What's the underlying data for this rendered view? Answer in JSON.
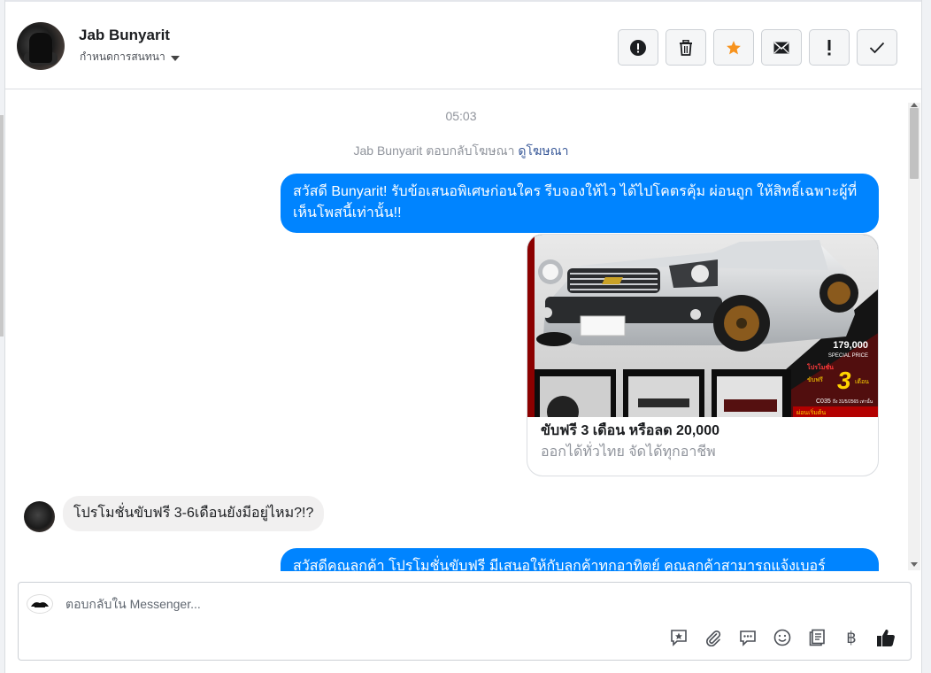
{
  "header": {
    "name": "Jab Bunyarit",
    "assign_label": "กำหนดการสนทนา",
    "actions": [
      {
        "icon": "alert-circle-icon"
      },
      {
        "icon": "trash-icon"
      },
      {
        "icon": "star-icon"
      },
      {
        "icon": "envelope-icon"
      },
      {
        "icon": "exclamation-icon"
      },
      {
        "icon": "check-icon"
      }
    ]
  },
  "thread": {
    "time": "05:03",
    "reply_note_prefix": "Jab Bunyarit ตอบกลับโฆษณา",
    "reply_note_link": "ดูโฆษณา",
    "msg1": "สวัสดี Bunyarit! รับข้อเสนอพิเศษก่อนใคร รีบจองให้ไว ได้ไปโคตรคุ้ม ผ่อนถูก ให้สิทธิ์เฉพาะผู้ที่เห็นโพสนี้เท่านั้น!!",
    "card": {
      "title": "ขับฟรี 3 เดือน หรือลด 20,000",
      "subtitle": "ออกได้ทั่วไทย จัดได้ทุกอาชีพ",
      "image_price": "179,000",
      "image_special": "SPECIAL PRICE",
      "image_promo_line1": "โปรโมชั่น",
      "image_promo_line2": "ขับฟรี",
      "image_promo_num": "3",
      "image_promo_unit": "เดือน",
      "image_code": "C035",
      "image_code_note": "ถึง 31/5/2565 เท่านั้น",
      "image_tag": "ผ่อนเริ่มต้น"
    },
    "msg2": "โปรโมชั่นขับฟรี 3-6เดือนยังมีอยู่ไหม?!?",
    "msg3": "สวัสดีคุณลูกค้า โปรโมชั่นขับฟรี มีเสนอให้กับลูกค้าทุกอาทิตย์ คุณลูกค้าสามารถแจ้งเบอร์"
  },
  "composer": {
    "placeholder": "ตอบกลับใน Messenger...",
    "tools": [
      "saved-reply-icon",
      "attach-icon",
      "chat-icon",
      "emoji-icon",
      "notes-icon",
      "baht-icon",
      "like-icon"
    ],
    "baht_symbol": "฿"
  },
  "colors": {
    "accent": "#0084ff",
    "star": "#f7931e"
  }
}
